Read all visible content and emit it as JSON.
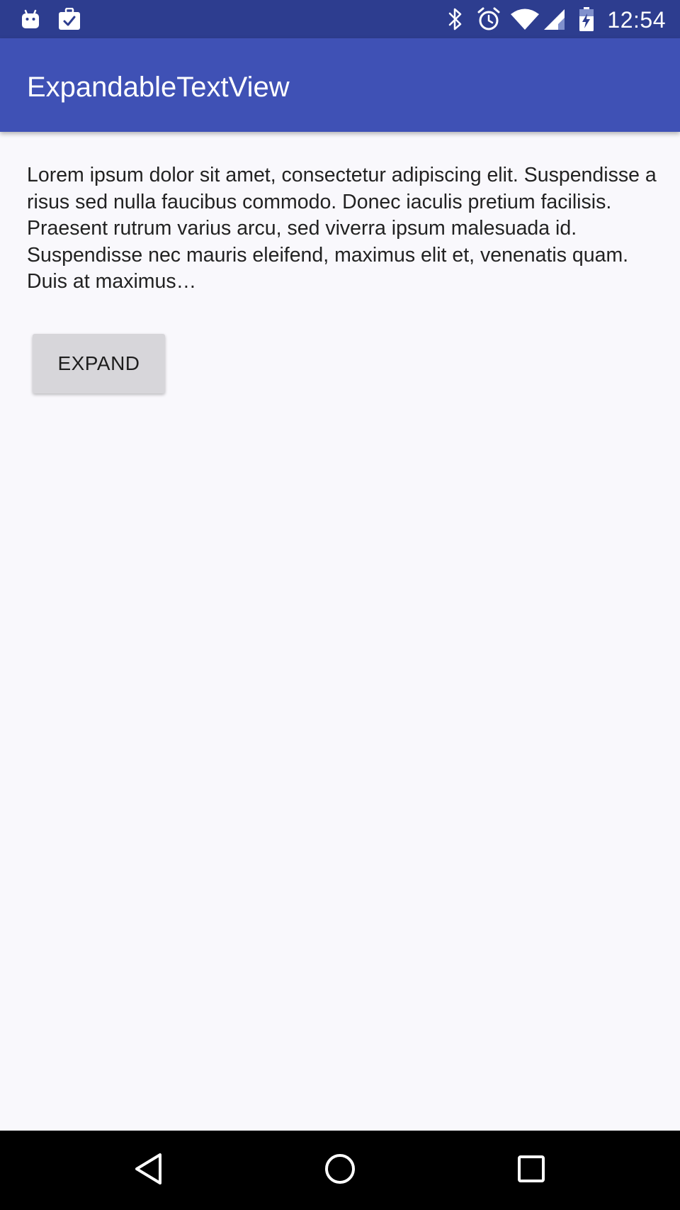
{
  "status_bar": {
    "time": "12:54",
    "left_icons": [
      "android-notification-icon",
      "task-notification-icon"
    ],
    "right_icons": [
      "bluetooth-icon",
      "alarm-icon",
      "wifi-icon",
      "signal-icon",
      "battery-charging-icon"
    ],
    "background_color": "#2d3d8f"
  },
  "app_bar": {
    "title": "ExpandableTextView",
    "background_color": "#3f51b5"
  },
  "content": {
    "text": "Lorem ipsum dolor sit amet, consectetur adipiscing elit. Suspendisse a risus sed nulla faucibus commodo. Donec iaculis pretium facilisis. Praesent rutrum varius arcu, sed viverra ipsum malesuada id. Suspendisse nec mauris eleifend, maximus elit et, venenatis quam. Duis at maximus…",
    "max_lines": 5,
    "expand_button_label": "EXPAND"
  },
  "nav_bar": {
    "buttons": [
      "back-icon",
      "home-icon",
      "recents-icon"
    ]
  }
}
